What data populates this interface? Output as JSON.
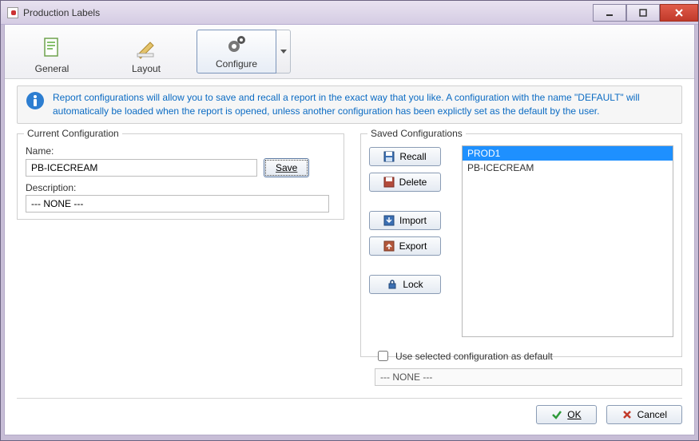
{
  "window": {
    "title": "Production Labels"
  },
  "toolbar": {
    "general": {
      "label": "General",
      "icon": "document-icon"
    },
    "layout": {
      "label": "Layout",
      "icon": "pencil-ruler-icon"
    },
    "configure": {
      "label": "Configure",
      "icon": "gears-icon",
      "active": true
    }
  },
  "info": {
    "text": "Report configurations will allow you to save and recall a report in the exact way that you like.  A configuration with the name \"DEFAULT\" will automatically be loaded when the report is opened, unless another configuration has been explictly set as the default by the user."
  },
  "currentConfig": {
    "legend": "Current Configuration",
    "nameLabel": "Name:",
    "nameValue": "PB-ICECREAM",
    "descLabel": "Description:",
    "descValue": "--- NONE ---",
    "saveLabel": "Save"
  },
  "savedConfig": {
    "legend": "Saved Configurations",
    "buttons": {
      "recall": "Recall",
      "delete": "Delete",
      "import": "Import",
      "export": "Export",
      "lock": "Lock"
    },
    "items": [
      {
        "label": "PROD1",
        "selected": true
      },
      {
        "label": "PB-ICECREAM",
        "selected": false
      }
    ]
  },
  "defaultConfig": {
    "checkboxLabel": "Use selected configuration as default",
    "checked": false,
    "display": "--- NONE ---"
  },
  "footer": {
    "ok": "OK",
    "cancel": "Cancel"
  }
}
